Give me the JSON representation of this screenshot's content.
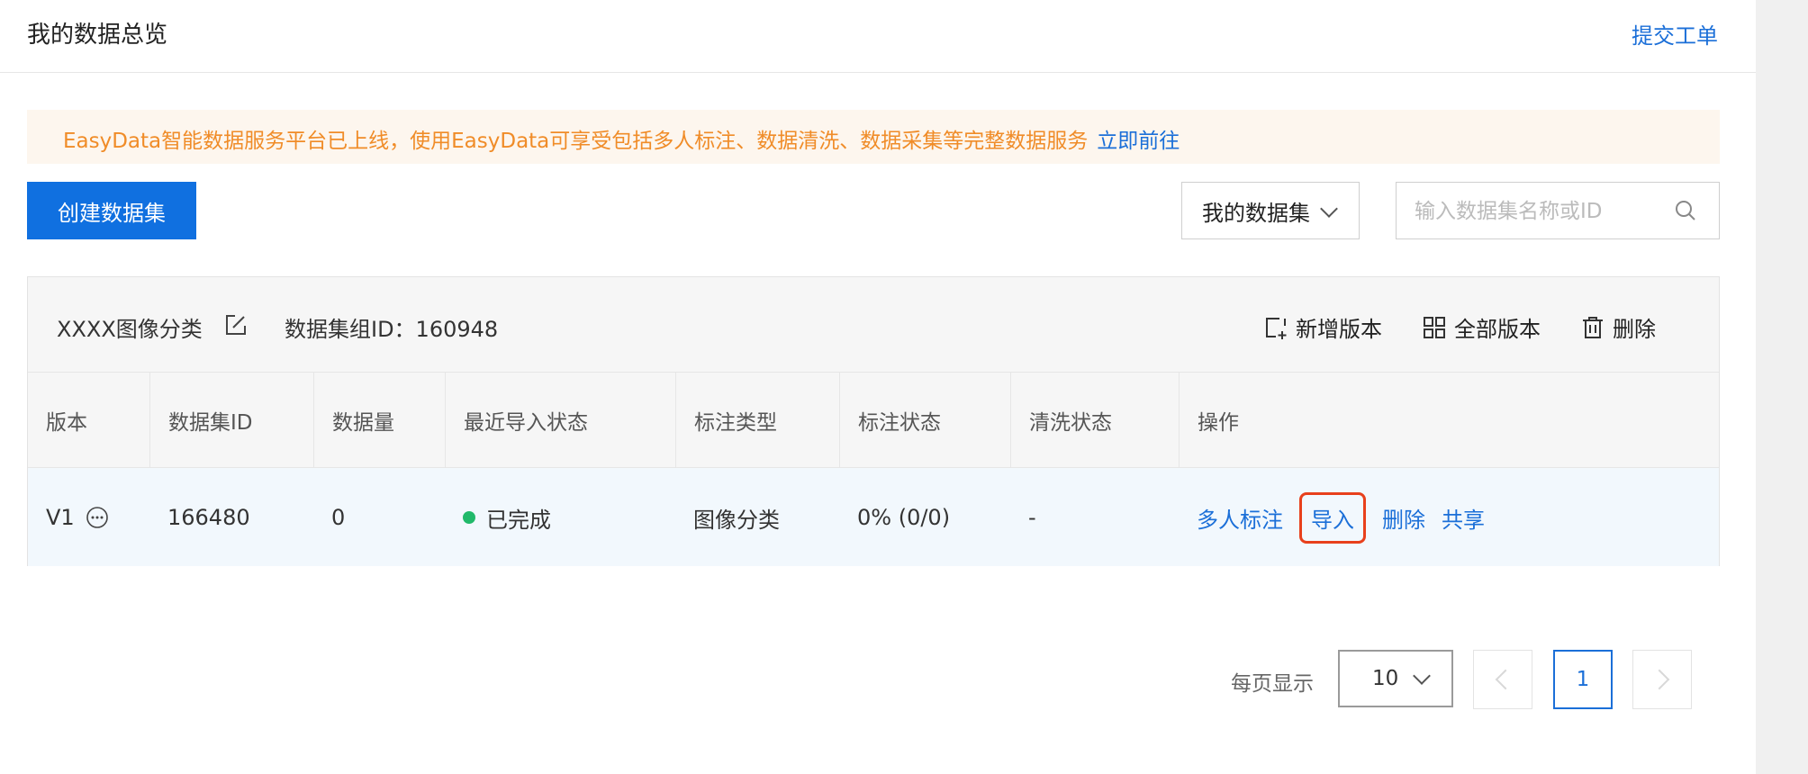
{
  "header": {
    "title": "我的数据总览",
    "ticket_link": "提交工单"
  },
  "notice": {
    "text": "EasyData智能数据服务平台已上线，使用EasyData可享受包括多人标注、数据清洗、数据采集等完整数据服务",
    "link": "立即前往"
  },
  "toolbar": {
    "create_label": "创建数据集",
    "dataset_filter": "我的数据集",
    "search_placeholder": "输入数据集名称或ID"
  },
  "group": {
    "name": "XXXX图像分类",
    "id_text": "数据集组ID：160948",
    "actions": {
      "add_version": "新增版本",
      "all_versions": "全部版本",
      "delete": "删除"
    }
  },
  "table": {
    "headers": [
      "版本",
      "数据集ID",
      "数据量",
      "最近导入状态",
      "标注类型",
      "标注状态",
      "清洗状态",
      "操作"
    ],
    "rows": [
      {
        "version": "V1",
        "dataset_id": "166480",
        "count": "0",
        "import_status": "已完成",
        "annotation_type": "图像分类",
        "annotation_status": "0% (0/0)",
        "clean_status": "-",
        "ops": [
          "多人标注",
          "导入",
          "删除",
          "共享"
        ]
      }
    ]
  },
  "pagination": {
    "per_page_label": "每页显示",
    "page_size": "10",
    "current_page": "1"
  },
  "colors": {
    "primary": "#1070e0",
    "link": "#1b6fd8",
    "notice_text": "#f08c28",
    "success_dot": "#21b96a",
    "highlight": "#e8401c"
  }
}
